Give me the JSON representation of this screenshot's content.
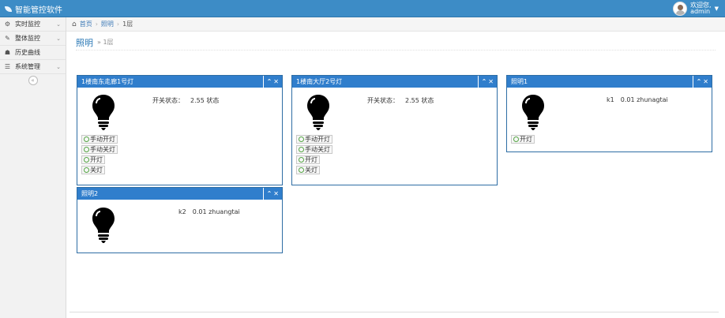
{
  "app": {
    "title": "智能管控软件"
  },
  "user": {
    "greeting": "欢迎您,",
    "name": "admin"
  },
  "sidebar": {
    "items": [
      {
        "label": "实时监控",
        "icon": "dashboard-icon",
        "glyph": "⚙",
        "expandable": true
      },
      {
        "label": "整体监控",
        "icon": "pencil-icon",
        "glyph": "✎",
        "expandable": true
      },
      {
        "label": "历史曲线",
        "icon": "users-icon",
        "glyph": "☗",
        "expandable": false
      },
      {
        "label": "系统管理",
        "icon": "list-icon",
        "glyph": "☰",
        "expandable": true
      }
    ],
    "collapse_glyph": "«"
  },
  "breadcrumb": {
    "home": "首页",
    "section": "照明",
    "current": "1层",
    "sep": "›"
  },
  "page_header": {
    "title": "照明",
    "subtitle": "» 1层"
  },
  "widgets": [
    {
      "title": "1楼南东走廊1号灯",
      "status": [
        "开关状态：",
        "2.55 状态"
      ],
      "buttons": [
        "手动开灯",
        "手动关灯",
        "开灯",
        "关灯"
      ]
    },
    {
      "title": "1楼南大厅2号灯",
      "status": [
        "开关状态：",
        "2.55 状态"
      ],
      "buttons": [
        "手动开灯",
        "手动关灯",
        "开灯",
        "关灯"
      ]
    },
    {
      "title": "照明1",
      "status": [
        "k1",
        "0.01 zhunagtai"
      ],
      "buttons": [
        "开灯"
      ]
    },
    {
      "title": "照明2",
      "status": [
        "k2",
        "0.01 zhuangtai"
      ],
      "buttons": []
    }
  ],
  "widget_tools": {
    "collapse": "⌃",
    "close": "✕"
  },
  "colors": {
    "accent": "#3d8cc6",
    "widget_header": "#307ecc",
    "toggle_ring": "#55a545"
  }
}
